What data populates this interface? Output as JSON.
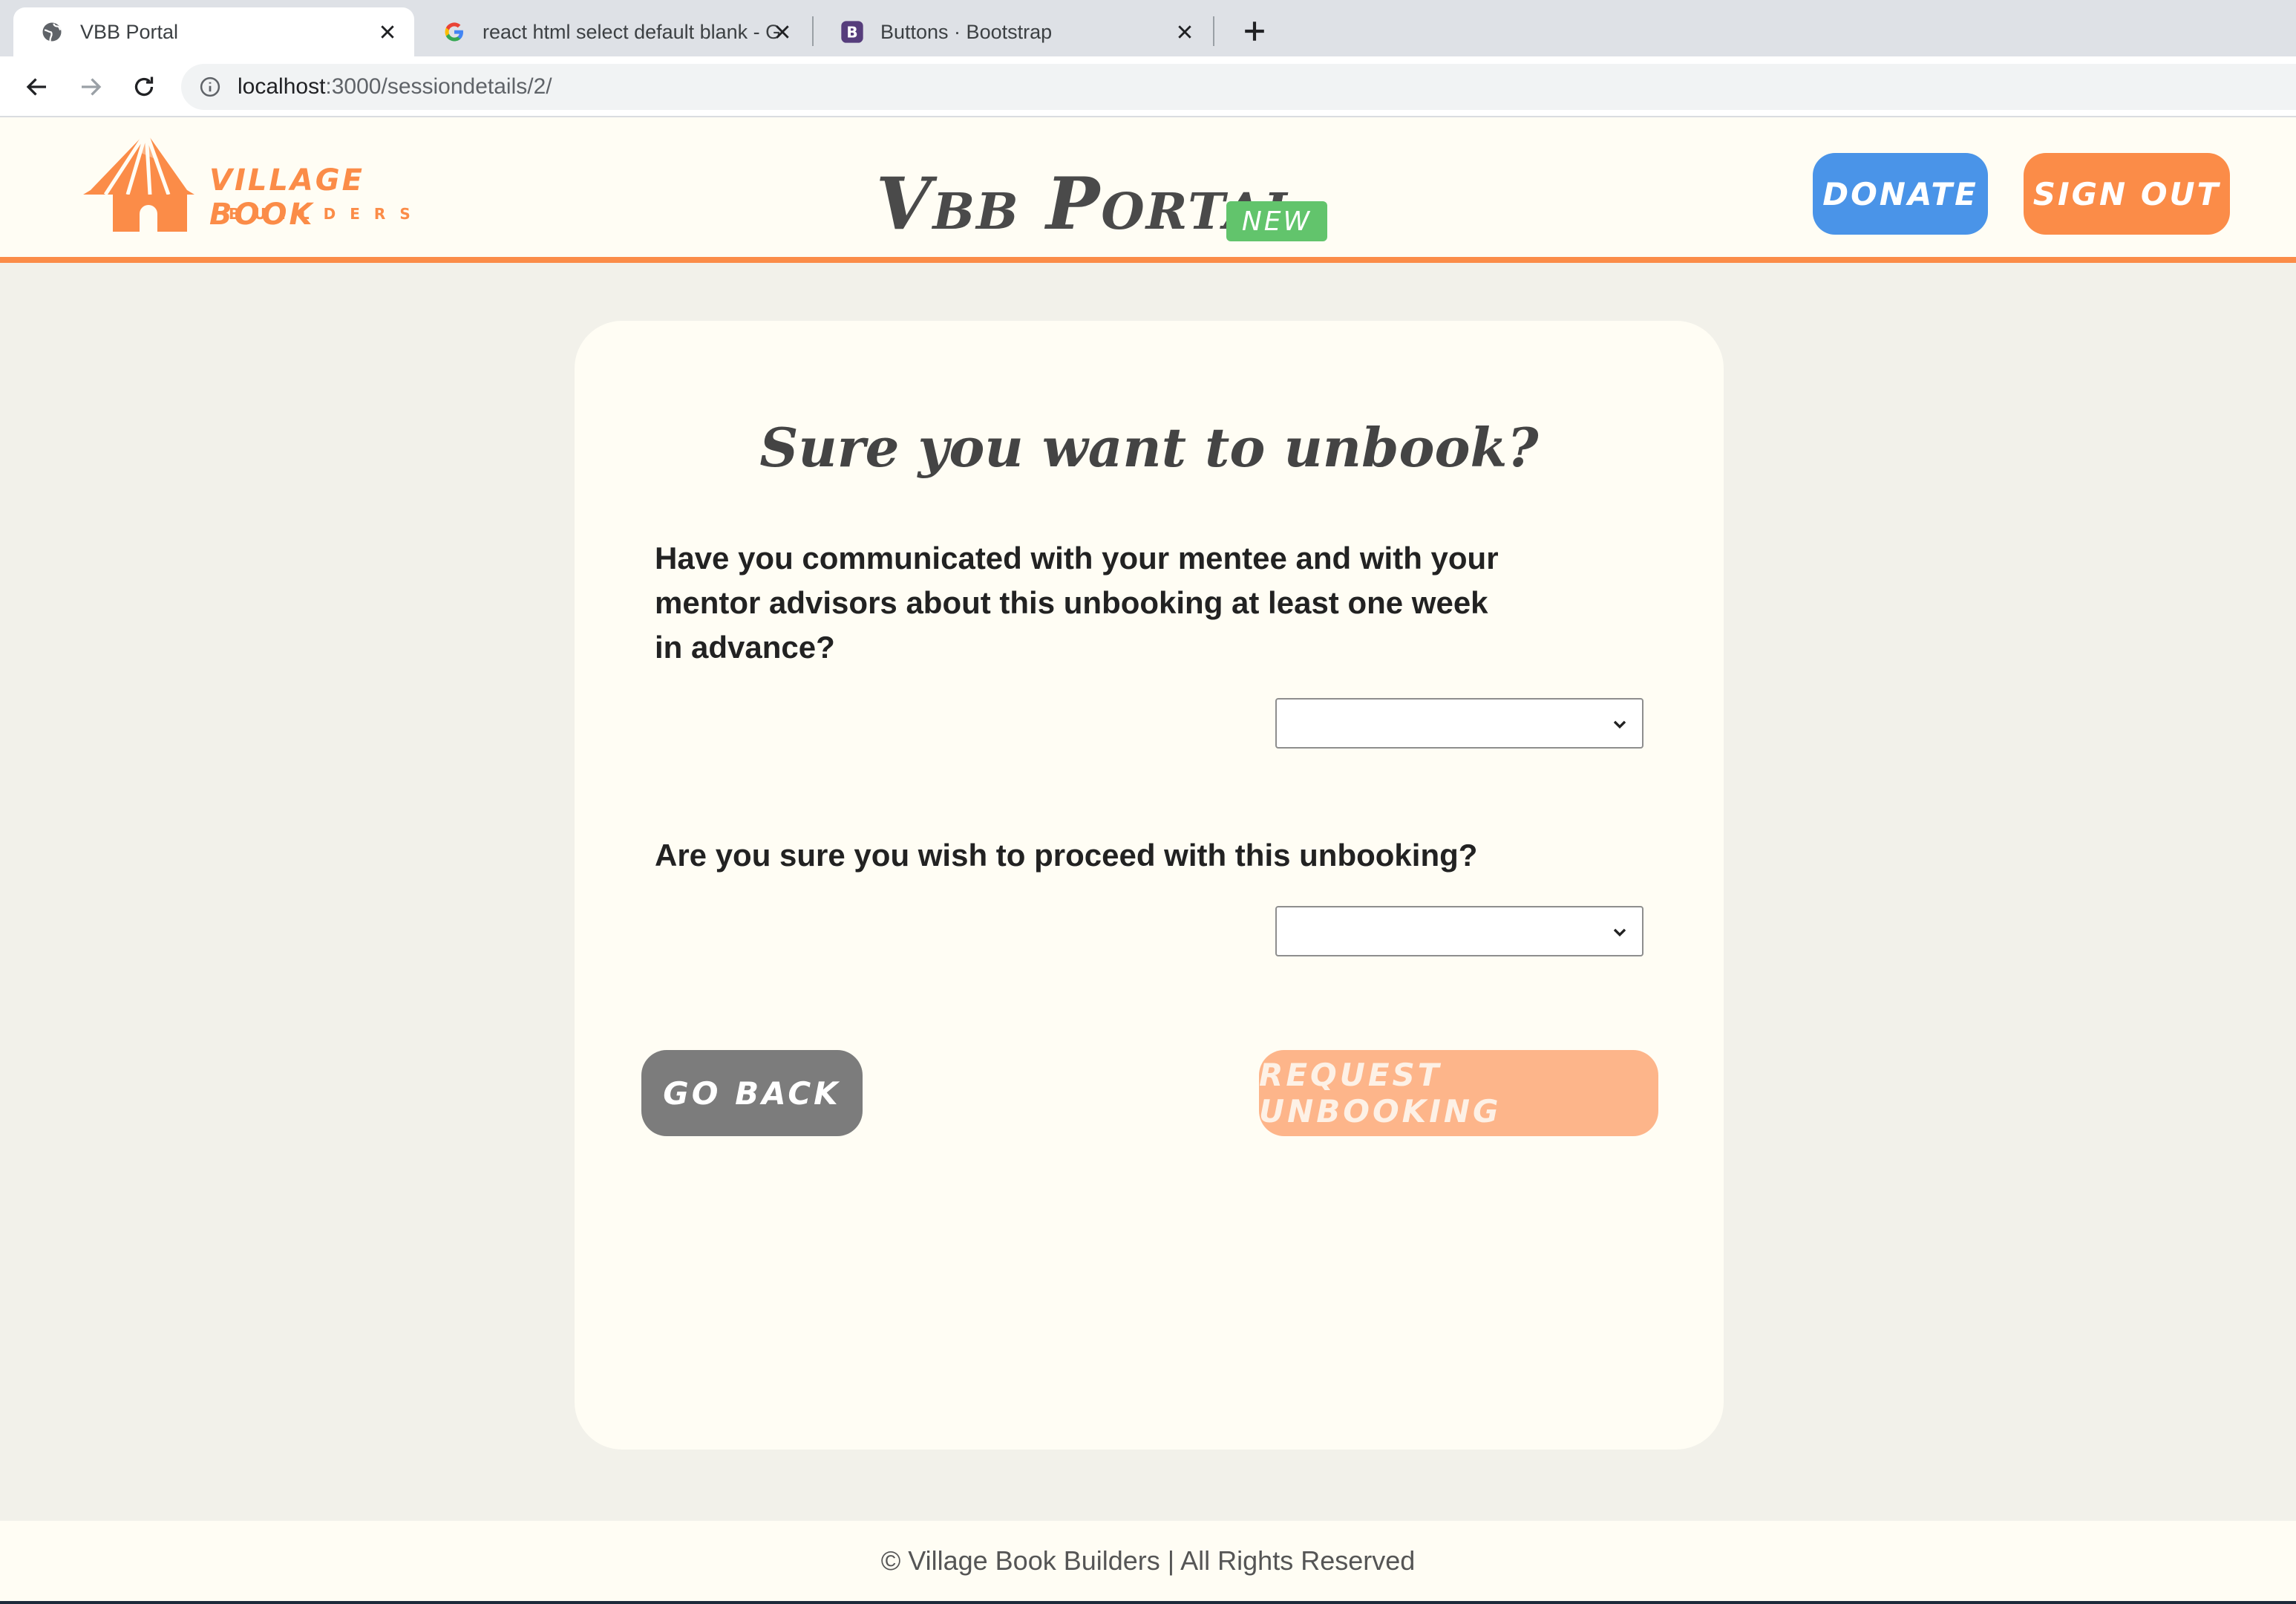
{
  "browser": {
    "tabs": [
      {
        "title": "VBB Portal",
        "icon": "globe-icon",
        "active": true
      },
      {
        "title": "react html select default blank - G",
        "icon": "google-icon",
        "active": false
      },
      {
        "title": "Buttons · Bootstrap",
        "icon": "bootstrap-icon",
        "active": false
      }
    ],
    "url_host": "localhost",
    "url_path": ":3000/sessiondetails/2/"
  },
  "header": {
    "logo_line1": "VILLAGE BOOK",
    "logo_line2": "BUILDERS",
    "title": "Vbb Portal",
    "badge": "NEW",
    "donate_label": "DONATE",
    "signout_label": "SIGN OUT"
  },
  "card": {
    "title": "Sure you want to unbook?",
    "question1": "Have you communicated with your mentee and with your mentor advisors about this unbooking at least one week in advance?",
    "question1_value": "",
    "question2": "Are you sure you wish to proceed with this unbooking?",
    "question2_value": "",
    "go_back_label": "GO BACK",
    "request_label": "REQUEST UNBOOKING"
  },
  "footer": {
    "text": "© Village Book Builders | All Rights Reserved"
  },
  "colors": {
    "accent_orange": "#fb8c48",
    "donate_blue": "#4a94e8",
    "badge_green": "#62c46c",
    "page_bg": "#f2f1ea",
    "card_bg": "#fffdf4",
    "go_back_gray": "#7c7c7c",
    "request_disabled": "#fdb58a"
  }
}
